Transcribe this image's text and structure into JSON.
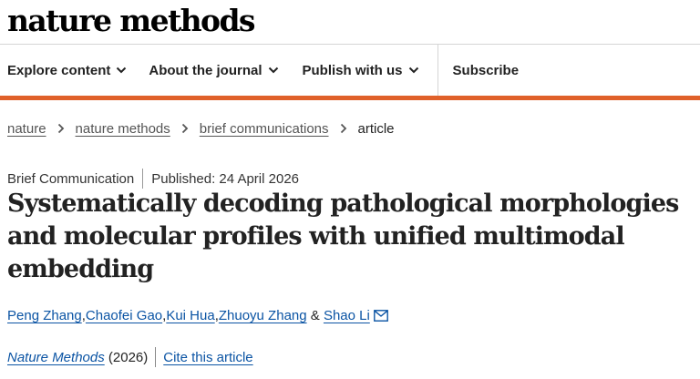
{
  "header": {
    "logo_text": "nature methods"
  },
  "nav": {
    "items": [
      {
        "label": "Explore content",
        "icon": "chevron-down-icon"
      },
      {
        "label": "About the journal",
        "icon": "chevron-down-icon"
      },
      {
        "label": "Publish with us",
        "icon": "chevron-down-icon"
      }
    ],
    "subscribe_label": "Subscribe"
  },
  "accent_color": "#e0612a",
  "link_color": "#0b54a4",
  "breadcrumb": {
    "items": [
      "nature",
      "nature methods",
      "brief communications"
    ],
    "current": "article",
    "separator_icon": "chevron-right-icon"
  },
  "article": {
    "type": "Brief Communication",
    "published": "Published: 24 April 2026",
    "title": "Systematically decoding pathological morphologies and molecular profiles with unified multimodal embedding",
    "authors": [
      "Peng Zhang",
      "Chaofei Gao",
      "Kui Hua",
      "Zhuoyu Zhang",
      "Shao Li"
    ],
    "author_separator": ", ",
    "author_conjunction": " & ",
    "corresponding_icon": "mail-icon",
    "journal": "Nature Methods",
    "year": " (2026)",
    "cite_label": "Cite this article"
  }
}
